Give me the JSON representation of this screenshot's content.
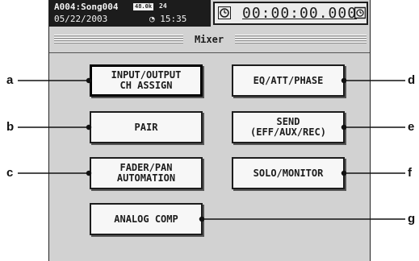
{
  "header": {
    "song": "A004:Song004",
    "date": "05/22/2003",
    "sample_rate": "48.0k",
    "bit_depth": "24",
    "time": "15:35",
    "counter": "00:00:00.000"
  },
  "title": "Mixer",
  "buttons": {
    "input_output": "INPUT/OUTPUT\nCH ASSIGN",
    "pair": "PAIR",
    "fader_pan": "FADER/PAN\nAUTOMATION",
    "analog_comp": "ANALOG COMP",
    "eq_att_phase": "EQ/ATT/PHASE",
    "send": "SEND\n(EFF/AUX/REC)",
    "solo_monitor": "SOLO/MONITOR"
  },
  "callouts": [
    "a",
    "b",
    "c",
    "d",
    "e",
    "f",
    "g"
  ]
}
